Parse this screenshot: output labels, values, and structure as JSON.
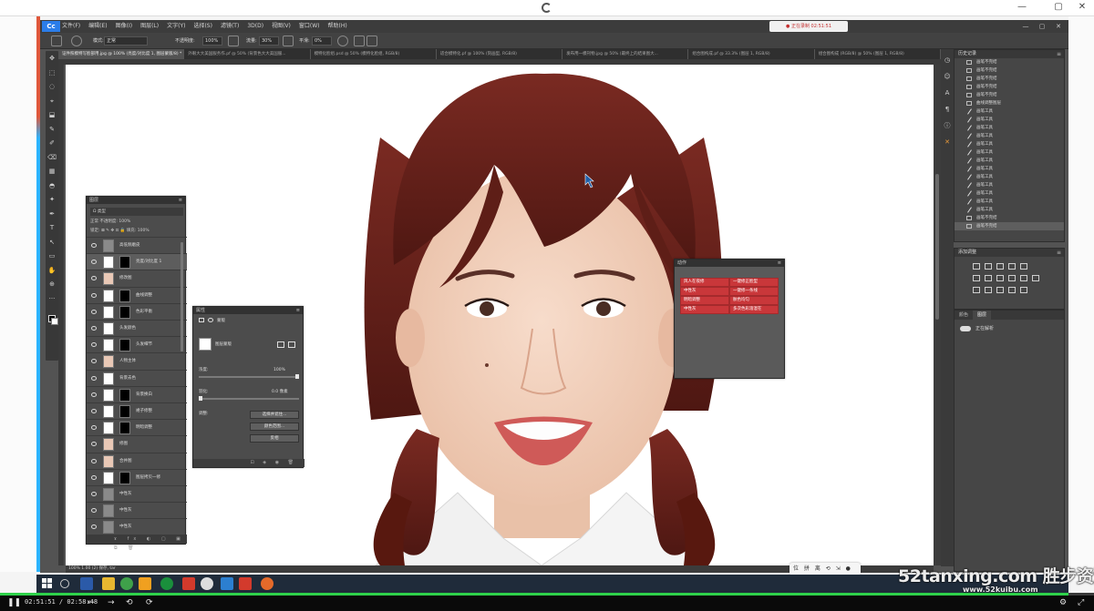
{
  "window": {
    "controls": [
      "—",
      "▢",
      "✕"
    ]
  },
  "photoshop": {
    "logo": "Cc",
    "menu": [
      "文件(F)",
      "编辑(E)",
      "图像(I)",
      "图层(L)",
      "文字(Y)",
      "选择(S)",
      "滤镜(T)",
      "3D(D)",
      "视图(V)",
      "窗口(W)",
      "帮助(H)"
    ],
    "notice": "● 正在录制 02:51:51",
    "options": {
      "mode_label": "模式:",
      "mode_value": "正常",
      "opacity_label": "不透明度:",
      "opacity_value": "100%",
      "flow_label": "流量:",
      "flow_value": "30%",
      "smooth_label": "平滑:",
      "smooth_value": "0%"
    },
    "tabs": [
      "证件照模特写脸部用.jpg @ 100% (亮度/对比度 1, 图层蒙版/8) *",
      "外眼大大美国服务作.pf @ 50% (背景色大大美国服...",
      "模特化脸组.psd @ 50% (模特化脸组, RGB/8)",
      "适合模特化.pf @ 100% (刻画型, RGB/8)",
      "发布用一模刊物.jpg @ 50% (最终上的结果图大...",
      "组合图构成.pf @ 33.3% (图层 1, RGB/8)",
      "组合图构成 (RGB/8) @ 50% (图层 1, RGB/8)"
    ],
    "status": "100%     1.00 (2) 保存, tar"
  },
  "history_panel": {
    "title": "历史记录",
    "items": [
      "画笔不完结",
      "画笔不完结",
      "画笔不完结",
      "画笔不完结",
      "画笔不完结",
      "曲线调整图层",
      "画笔工具",
      "画笔工具",
      "画笔工具",
      "画笔工具",
      "画笔工具",
      "画笔工具",
      "画笔工具",
      "画笔工具",
      "画笔工具",
      "画笔工具",
      "画笔工具",
      "画笔工具",
      "画笔工具",
      "画笔不完结",
      "画笔不完结"
    ],
    "brush_from": 6,
    "brush_to": 18
  },
  "adjust_panel": {
    "title": "添加调整"
  },
  "channels_panel": {
    "tabs": [
      "颜色",
      "图层"
    ],
    "cloud_label": "正在解析"
  },
  "layers_panel": {
    "title": "图层",
    "search": "Ω 类型",
    "mode": "正常                     不透明度: 100%",
    "lock": "锁定:  ⊠ ✎ ✥ ⊡ 🔒      填充: 100%",
    "layers": [
      {
        "name": "高低频磨皮",
        "thumb": "gray",
        "mask": false
      },
      {
        "name": "亮度/对比度 1",
        "thumb": "white",
        "mask": true
      },
      {
        "name": "修改图",
        "thumb": "face",
        "mask": false
      },
      {
        "name": "曲线调整",
        "thumb": "white",
        "mask": true
      },
      {
        "name": "色彩平衡",
        "thumb": "white",
        "mask": true
      },
      {
        "name": "头发颜色",
        "thumb": "white",
        "mask": false
      },
      {
        "name": "头发细节",
        "thumb": "white",
        "mask": true
      },
      {
        "name": "人物主体",
        "thumb": "face",
        "mask": false
      },
      {
        "name": "背景去色",
        "thumb": "white",
        "mask": false
      },
      {
        "name": "背景换白",
        "thumb": "white",
        "mask": true
      },
      {
        "name": "裙子修整",
        "thumb": "white",
        "mask": true
      },
      {
        "name": "明暗调整",
        "thumb": "white",
        "mask": true
      },
      {
        "name": "修图",
        "thumb": "face",
        "mask": false
      },
      {
        "name": "合并图",
        "thumb": "face",
        "mask": false
      },
      {
        "name": "图层拷贝一修",
        "thumb": "white",
        "mask": true
      },
      {
        "name": "中性灰",
        "thumb": "gray",
        "mask": false
      },
      {
        "name": "中性灰",
        "thumb": "gray",
        "mask": false
      },
      {
        "name": "中性灰",
        "thumb": "gray",
        "mask": false
      }
    ],
    "bottom_icons": "ɤ fx ◐ ▢ ▣ ⧉ 🗑"
  },
  "properties_panel": {
    "title": "属性",
    "tabs_label": "蒙版",
    "layer_label": "图层蒙版",
    "density_label": "浓度:",
    "density_value": "100%",
    "feather_label": "羽化:",
    "feather_value": "0.0 像素",
    "refine_label": "调整:",
    "buttons": [
      "选择并遮住...",
      "颜色范围...",
      "反相"
    ],
    "footer_icons": "⊡ ◈ ◉ 🗑"
  },
  "actions_panel": {
    "title": "动作",
    "items": [
      "风人在夜修",
      "一键修正脸型",
      "中性灰",
      "一键修一条线",
      "明暗调整",
      "肤色均匀",
      "中性灰",
      "多次色彩溶混在"
    ]
  },
  "mini_toolbar": {
    "label": "位 拼 离 ⟲ ⇲ ●"
  },
  "player": {
    "time": "02:51:51 / 02:58:48",
    "progress": 0.977
  },
  "watermark": {
    "big": "52tanxing.com 胜步资源论坛",
    "small": "www.52kuibu.com"
  }
}
